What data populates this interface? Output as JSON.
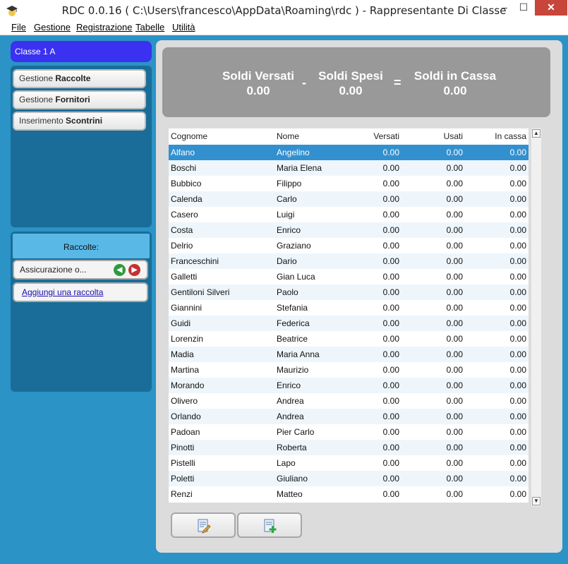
{
  "window": {
    "title": "RDC 0.0.16 ( C:\\Users\\francesco\\AppData\\Roaming\\rdc ) - Rappresentante Di Classe",
    "minimize": "–",
    "maximize": "☐",
    "close": "✕"
  },
  "menu": [
    "File",
    "Gestione",
    "Registrazione",
    "Tabelle",
    "Utilità"
  ],
  "sidebar": {
    "class_name": "Classe 1 A",
    "nav": [
      {
        "prefix": "Gestione ",
        "bold": "Raccolte"
      },
      {
        "prefix": "Gestione ",
        "bold": "Fornitori"
      },
      {
        "prefix": "Inserimento ",
        "bold": "Scontrini"
      }
    ],
    "raccolte_title": "Raccolte:",
    "raccolta_item": "Assicurazione o...",
    "add_raccolta": "Aggiungi una raccolta"
  },
  "summary": {
    "versati_label": "Soldi Versati",
    "versati_value": "0.00",
    "spesi_label": "Soldi Spesi",
    "spesi_value": "0.00",
    "cassa_label": "Soldi in Cassa",
    "cassa_value": "0.00",
    "minus": "-",
    "equals": "="
  },
  "table": {
    "headers": [
      "Cognome",
      "Nome",
      "Versati",
      "Usati",
      "In cassa"
    ],
    "rows": [
      [
        "Alfano",
        "Angelino",
        "0.00",
        "0.00",
        "0.00"
      ],
      [
        "Boschi",
        "Maria Elena",
        "0.00",
        "0.00",
        "0.00"
      ],
      [
        "Bubbico",
        "Filippo",
        "0.00",
        "0.00",
        "0.00"
      ],
      [
        "Calenda",
        "Carlo",
        "0.00",
        "0.00",
        "0.00"
      ],
      [
        "Casero",
        "Luigi",
        "0.00",
        "0.00",
        "0.00"
      ],
      [
        "Costa",
        "Enrico",
        "0.00",
        "0.00",
        "0.00"
      ],
      [
        "Delrio",
        "Graziano",
        "0.00",
        "0.00",
        "0.00"
      ],
      [
        "Franceschini",
        "Dario",
        "0.00",
        "0.00",
        "0.00"
      ],
      [
        "Galletti",
        "Gian Luca",
        "0.00",
        "0.00",
        "0.00"
      ],
      [
        "Gentiloni Silveri",
        "Paolo",
        "0.00",
        "0.00",
        "0.00"
      ],
      [
        "Giannini",
        "Stefania",
        "0.00",
        "0.00",
        "0.00"
      ],
      [
        "Guidi",
        "Federica",
        "0.00",
        "0.00",
        "0.00"
      ],
      [
        "Lorenzin",
        "Beatrice",
        "0.00",
        "0.00",
        "0.00"
      ],
      [
        "Madia",
        "Maria Anna",
        "0.00",
        "0.00",
        "0.00"
      ],
      [
        "Martina",
        "Maurizio",
        "0.00",
        "0.00",
        "0.00"
      ],
      [
        "Morando",
        "Enrico",
        "0.00",
        "0.00",
        "0.00"
      ],
      [
        "Olivero",
        "Andrea",
        "0.00",
        "0.00",
        "0.00"
      ],
      [
        "Orlando",
        "Andrea",
        "0.00",
        "0.00",
        "0.00"
      ],
      [
        "Padoan",
        "Pier Carlo",
        "0.00",
        "0.00",
        "0.00"
      ],
      [
        "Pinotti",
        "Roberta",
        "0.00",
        "0.00",
        "0.00"
      ],
      [
        "Pistelli",
        "Lapo",
        "0.00",
        "0.00",
        "0.00"
      ],
      [
        "Poletti",
        "Giuliano",
        "0.00",
        "0.00",
        "0.00"
      ],
      [
        "Renzi",
        "Matteo",
        "0.00",
        "0.00",
        "0.00"
      ]
    ],
    "selected_row": 0
  },
  "actions": {
    "edit_icon": "edit-document-icon",
    "add_icon": "add-document-icon"
  },
  "colors": {
    "background": "#2b93c6",
    "class_header": "#3a32f0",
    "selected_row": "#3390cf",
    "summary": "#999999"
  }
}
